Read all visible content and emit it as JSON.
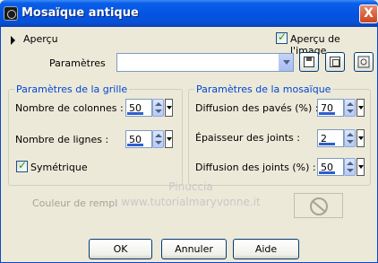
{
  "window": {
    "title": "Mosaïque antique",
    "close_label": "X"
  },
  "preview": {
    "toggle_label": "Aperçu",
    "image_preview_label": "Aperçu de l'image",
    "image_preview_checked": true
  },
  "presets": {
    "label": "Paramètres",
    "value": ""
  },
  "grid": {
    "title": "Paramètres de la grille",
    "columns_label": "Nombre de colonnes :",
    "columns_value": "50",
    "rows_label": "Nombre de lignes :",
    "rows_value": "50",
    "symmetric_label": "Symétrique",
    "symmetric_checked": true
  },
  "mosaic": {
    "title": "Paramètres de la mosaïque",
    "tile_diffusion_label": "Diffusion des pavés (%) :",
    "tile_diffusion_value": "70",
    "joint_thickness_label": "Épaisseur des joints :",
    "joint_thickness_value": "2",
    "joint_diffusion_label": "Diffusion des joints (%) :",
    "joint_diffusion_value": "50"
  },
  "fill": {
    "label": "Couleur de rempl"
  },
  "watermark": {
    "line1": "Pinuccia",
    "line2": "www.tutorialmaryvonne.it"
  },
  "buttons": {
    "ok": "OK",
    "cancel": "Annuler",
    "help": "Aide"
  },
  "icons": {
    "app": "app-icon",
    "save": "save-icon",
    "reset": "reset-icon",
    "settings": "settings-icon",
    "no_color": "no-color-icon"
  }
}
